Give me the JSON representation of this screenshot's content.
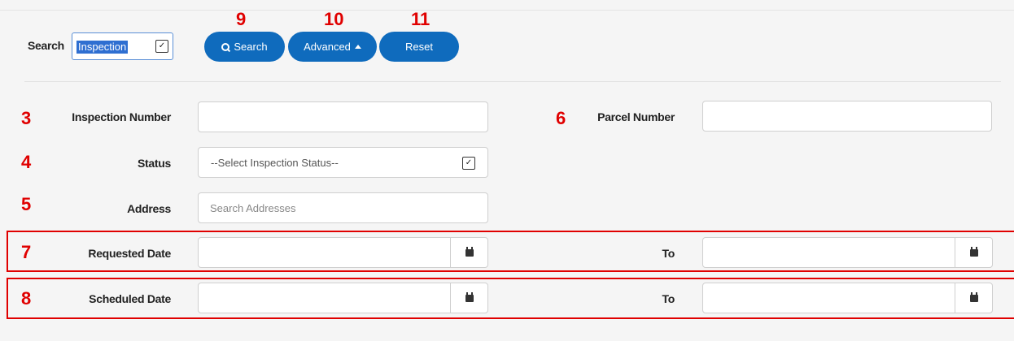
{
  "search": {
    "label": "Search",
    "type_value": "Inspection"
  },
  "buttons": {
    "search": "Search",
    "advanced": "Advanced",
    "reset": "Reset"
  },
  "markers": {
    "m3": "3",
    "m4": "4",
    "m5": "5",
    "m6": "6",
    "m7": "7",
    "m8": "8",
    "m9": "9",
    "m10": "10",
    "m11": "11"
  },
  "fields": {
    "inspection_number": {
      "label": "Inspection Number",
      "value": ""
    },
    "parcel_number": {
      "label": "Parcel Number",
      "value": ""
    },
    "status": {
      "label": "Status",
      "placeholder": "--Select Inspection Status--"
    },
    "address": {
      "label": "Address",
      "placeholder": "Search Addresses"
    },
    "requested_date": {
      "label": "Requested Date",
      "to_label": "To"
    },
    "scheduled_date": {
      "label": "Scheduled Date",
      "to_label": "To"
    }
  },
  "icons": {
    "search": "search-icon",
    "caret": "caret-up-icon",
    "calendar": "calendar-icon",
    "chevron": "chevron-down-icon"
  },
  "colors": {
    "primary_button": "#0f6bbd",
    "marker": "#e00000",
    "selection": "#2f6fd1"
  }
}
